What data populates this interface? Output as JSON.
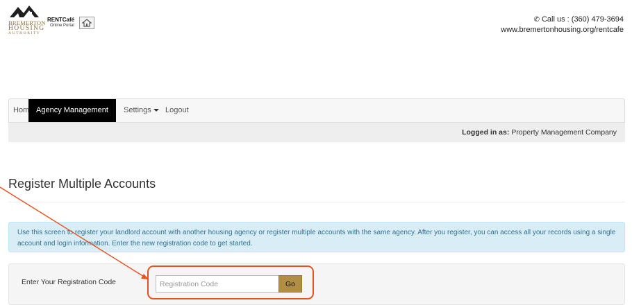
{
  "header": {
    "logo": {
      "line1": "BREMERTON",
      "line2": "HOUSING",
      "line3": "AUTHORITY",
      "roof_color": "#1f1f1f",
      "text_color": "#8a6d3b"
    },
    "portal": {
      "title": "RENTCafé",
      "subtitle": "Online Portal"
    },
    "contact": {
      "phone": "Call us : (360) 479-3694",
      "website": "www.bremertonhousing.org/rentcafe"
    }
  },
  "nav": {
    "items": [
      {
        "label": "Home"
      },
      {
        "label": "Agency Management",
        "active": true
      },
      {
        "label": "Settings",
        "dropdown": true
      },
      {
        "label": "Logout"
      }
    ]
  },
  "login_status": {
    "label": "Logged in as:",
    "value": "Property Management Company"
  },
  "page": {
    "title": "Register Multiple Accounts",
    "info": "Use this screen to register your landlord account with another housing agency or register multiple accounts with the same agency. After you register, you can access all your records using a single account and login information. Enter the new registration code to get started."
  },
  "form": {
    "label": "Enter Your Registration Code",
    "input_value": "",
    "input_placeholder": "Registration Code",
    "button_label": "Go"
  },
  "colors": {
    "nav_active_bg": "#000000",
    "info_bg": "#d9edf7",
    "info_text": "#31708f",
    "go_button_bg": "#b08e45",
    "annotation": "#e8501f"
  },
  "icons": {
    "phone": "phone-icon",
    "caret": "caret-down-icon",
    "portal_badge": "house-icon"
  }
}
